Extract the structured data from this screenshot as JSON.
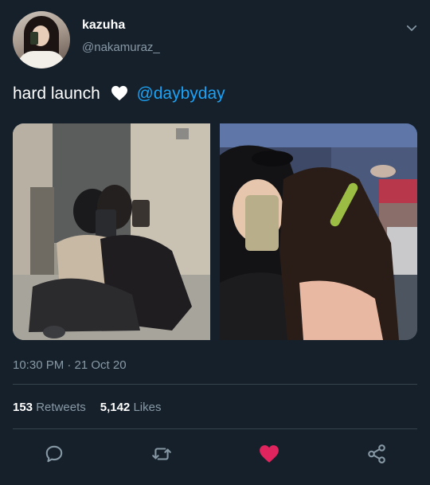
{
  "user": {
    "display_name": "kazuha",
    "handle": "@nakamuraz_"
  },
  "tweet": {
    "text": "hard launch",
    "emoji": "white-heart",
    "mention": "@daybyday"
  },
  "meta": {
    "timestamp": "10:30 PM · 21 Oct 20"
  },
  "stats": {
    "retweets_count": "153",
    "retweets_label": "Retweets",
    "likes_count": "5,142",
    "likes_label": "Likes"
  },
  "actions": {
    "liked": true
  },
  "colors": {
    "background": "#15202b",
    "accent": "#1da1f2",
    "like": "#e0245e",
    "muted": "#8899a6",
    "divider": "#38444d"
  }
}
